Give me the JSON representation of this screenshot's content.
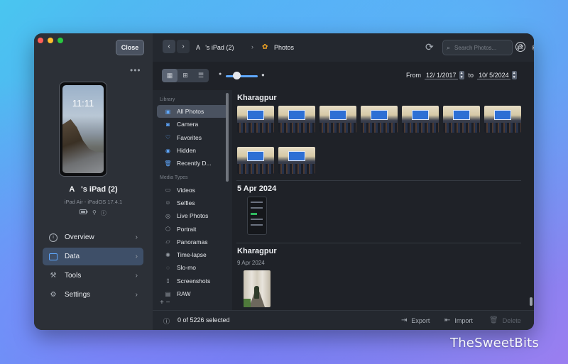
{
  "window": {
    "close_label": "Close",
    "more_label": "•••"
  },
  "device": {
    "lock_time": "11:11",
    "name": "A    's iPad (2)",
    "model": "iPad Air - iPadOS 17.4.1"
  },
  "nav": [
    {
      "label": "Overview",
      "icon": "info-icon"
    },
    {
      "label": "Data",
      "icon": "data-icon",
      "active": true
    },
    {
      "label": "Tools",
      "icon": "tools-icon"
    },
    {
      "label": "Settings",
      "icon": "gear-icon"
    }
  ],
  "toolbar": {
    "back": "‹",
    "forward": "›",
    "breadcrumb_device": "A    's iPad (2)",
    "breadcrumb_sep": "›",
    "breadcrumb_section": "Photos",
    "search_placeholder": "Search Photos..."
  },
  "view": {
    "from_label": "From",
    "from_date": "12/ 1/2017",
    "to_label": "to",
    "to_date": "10/ 5/2024",
    "zoom_level": 0.35
  },
  "library": {
    "heading": "Library",
    "items": [
      "All Photos",
      "Camera",
      "Favorites",
      "Hidden",
      "Recently D..."
    ],
    "media_heading": "Media Types",
    "media_items": [
      "Videos",
      "Selfies",
      "Live Photos",
      "Portrait",
      "Panoramas",
      "Time-lapse",
      "Slo-mo",
      "Screenshots",
      "RAW"
    ],
    "footer": "+  −"
  },
  "gallery": {
    "group1_title": "Kharagpur",
    "group2_title": "5 Apr 2024",
    "group3_title": "Kharagpur",
    "group3_date": "9 Apr 2024"
  },
  "status": {
    "selected_text": "0 of 5226 selected",
    "export_label": "Export",
    "import_label": "Import",
    "delete_label": "Delete"
  },
  "watermark": "TheSweetBits"
}
